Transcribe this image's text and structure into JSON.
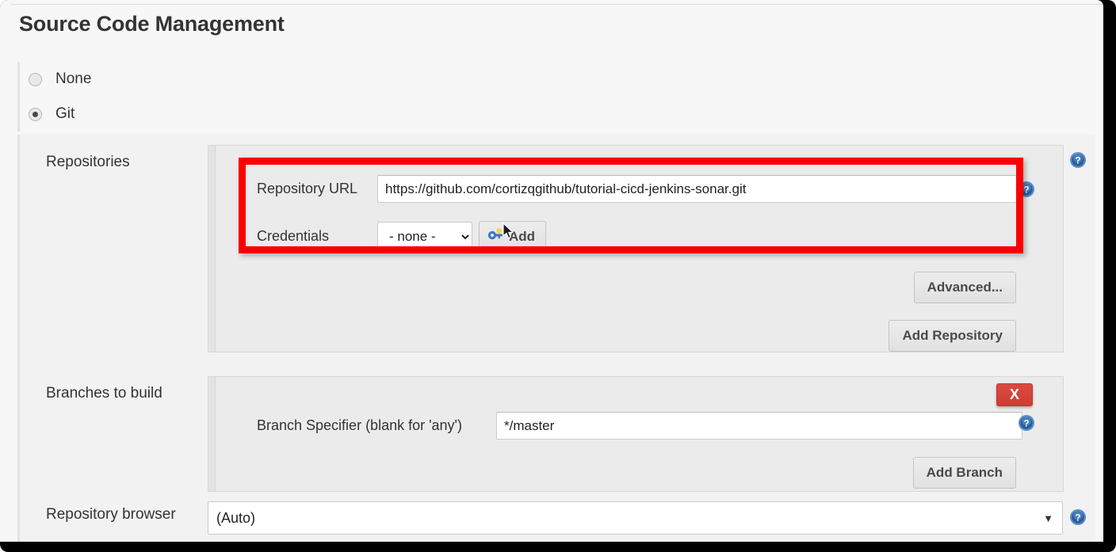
{
  "page": {
    "title": "Source Code Management"
  },
  "scm_options": [
    {
      "label": "None",
      "checked": false,
      "name": "none"
    },
    {
      "label": "Git",
      "checked": true,
      "name": "git"
    }
  ],
  "repositories": {
    "section_label": "Repositories",
    "repository_url": {
      "label": "Repository URL",
      "value": "https://github.com/cortizqgithub/tutorial-cicd-jenkins-sonar.git",
      "placeholder": ""
    },
    "credentials": {
      "label": "Credentials",
      "selected": "- none -",
      "options": [
        "- none -"
      ],
      "add_button_label": "Add",
      "add_button_icon": "key-icon"
    },
    "advanced_button_label": "Advanced...",
    "add_repository_button_label": "Add Repository",
    "help_icon": "help-icon"
  },
  "branches": {
    "section_label": "Branches to build",
    "branch_specifier": {
      "label": "Branch Specifier (blank for 'any')",
      "value": "*/master",
      "placeholder": ""
    },
    "delete_button_label": "X",
    "add_branch_button_label": "Add Branch",
    "help_icon": "help-icon"
  },
  "repository_browser": {
    "label": "Repository browser",
    "selected": "(Auto)",
    "options": [
      "(Auto)"
    ],
    "caret": "▼",
    "help_icon": "help-icon"
  },
  "colors": {
    "highlight": "#fb0000",
    "delete": "#d9453c",
    "help_blue": "#2a5d9e",
    "page_bg": "#f7f7f7",
    "panel_bg": "#ebebeb"
  }
}
